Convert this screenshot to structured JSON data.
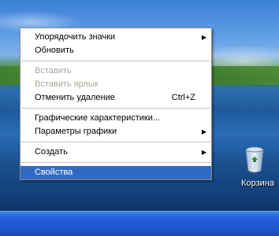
{
  "context_menu": {
    "items": [
      {
        "label": "Упорядочить значки",
        "submenu": true,
        "state": "normal"
      },
      {
        "label": "Обновить",
        "state": "normal"
      },
      {
        "label": "Вставить",
        "state": "disabled"
      },
      {
        "label": "Вставить ярлык",
        "state": "disabled"
      },
      {
        "label": "Отменить удаление",
        "shortcut": "Ctrl+Z",
        "state": "normal"
      },
      {
        "label": "Графические характеристики...",
        "state": "normal"
      },
      {
        "label": "Параметры графики",
        "submenu": true,
        "state": "normal"
      },
      {
        "label": "Создать",
        "submenu": true,
        "state": "normal"
      },
      {
        "label": "Свойства",
        "state": "selected"
      }
    ]
  },
  "desktop": {
    "recycle_bin_label": "Корзина",
    "recycle_bin_icon": "recycle-bin-icon"
  },
  "colors": {
    "selection": "#316ac5",
    "taskbar": "#245edb",
    "disabled_text": "#a7a69b"
  }
}
